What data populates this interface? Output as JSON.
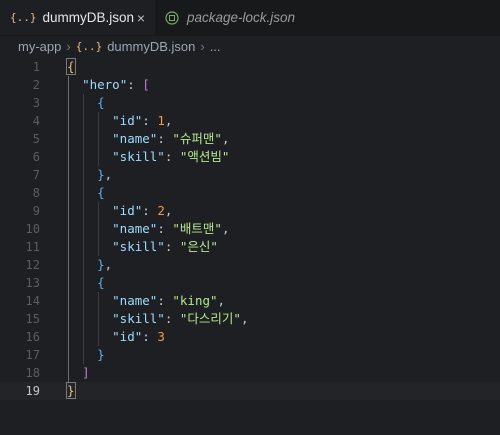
{
  "tabs": [
    {
      "icon": "{..}",
      "label": "dummyDB.json",
      "close": "×",
      "active": true
    },
    {
      "label": "package-lock.json",
      "active": false
    }
  ],
  "breadcrumb": {
    "folder": "my-app",
    "file_icon": "{..}",
    "file": "dummyDB.json",
    "more": "..."
  },
  "colors": {
    "brace": "#e5c07b",
    "bracket": "#c678dd",
    "inner_brace": "#61afef",
    "key": "#9cdcfe",
    "string": "#b5e890",
    "number": "#f09a4c"
  },
  "lines": [
    {
      "n": "1",
      "tokens": [
        [
          "{",
          "b1"
        ]
      ]
    },
    {
      "n": "2",
      "tokens": [
        [
          "  ",
          ""
        ],
        [
          "\"hero\"",
          "key"
        ],
        [
          ": ",
          "punc"
        ],
        [
          "[",
          "b2"
        ]
      ]
    },
    {
      "n": "3",
      "tokens": [
        [
          "    ",
          ""
        ],
        [
          "{",
          "b3"
        ]
      ]
    },
    {
      "n": "4",
      "tokens": [
        [
          "      ",
          ""
        ],
        [
          "\"id\"",
          "key"
        ],
        [
          ": ",
          "punc"
        ],
        [
          "1",
          "num"
        ],
        [
          ",",
          "punc"
        ]
      ]
    },
    {
      "n": "5",
      "tokens": [
        [
          "      ",
          ""
        ],
        [
          "\"name\"",
          "key"
        ],
        [
          ": ",
          "punc"
        ],
        [
          "\"슈퍼맨\"",
          "str"
        ],
        [
          ",",
          "punc"
        ]
      ]
    },
    {
      "n": "6",
      "tokens": [
        [
          "      ",
          ""
        ],
        [
          "\"skill\"",
          "key"
        ],
        [
          ": ",
          "punc"
        ],
        [
          "\"액션빔\"",
          "str"
        ]
      ]
    },
    {
      "n": "7",
      "tokens": [
        [
          "    ",
          ""
        ],
        [
          "}",
          "b3"
        ],
        [
          ",",
          "punc"
        ]
      ]
    },
    {
      "n": "8",
      "tokens": [
        [
          "    ",
          ""
        ],
        [
          "{",
          "b3"
        ]
      ]
    },
    {
      "n": "9",
      "tokens": [
        [
          "      ",
          ""
        ],
        [
          "\"id\"",
          "key"
        ],
        [
          ": ",
          "punc"
        ],
        [
          "2",
          "num"
        ],
        [
          ",",
          "punc"
        ]
      ]
    },
    {
      "n": "10",
      "tokens": [
        [
          "      ",
          ""
        ],
        [
          "\"name\"",
          "key"
        ],
        [
          ": ",
          "punc"
        ],
        [
          "\"배트맨\"",
          "str"
        ],
        [
          ",",
          "punc"
        ]
      ]
    },
    {
      "n": "11",
      "tokens": [
        [
          "      ",
          ""
        ],
        [
          "\"skill\"",
          "key"
        ],
        [
          ": ",
          "punc"
        ],
        [
          "\"은신\"",
          "str"
        ]
      ]
    },
    {
      "n": "12",
      "tokens": [
        [
          "    ",
          ""
        ],
        [
          "}",
          "b3"
        ],
        [
          ",",
          "punc"
        ]
      ]
    },
    {
      "n": "13",
      "tokens": [
        [
          "    ",
          ""
        ],
        [
          "{",
          "b3"
        ]
      ]
    },
    {
      "n": "14",
      "tokens": [
        [
          "      ",
          ""
        ],
        [
          "\"name\"",
          "key"
        ],
        [
          ": ",
          "punc"
        ],
        [
          "\"king\"",
          "str"
        ],
        [
          ",",
          "punc"
        ]
      ]
    },
    {
      "n": "15",
      "tokens": [
        [
          "      ",
          ""
        ],
        [
          "\"skill\"",
          "key"
        ],
        [
          ": ",
          "punc"
        ],
        [
          "\"다스리기\"",
          "str"
        ],
        [
          ",",
          "punc"
        ]
      ]
    },
    {
      "n": "16",
      "tokens": [
        [
          "      ",
          ""
        ],
        [
          "\"id\"",
          "key"
        ],
        [
          ": ",
          "punc"
        ],
        [
          "3",
          "num"
        ]
      ]
    },
    {
      "n": "17",
      "tokens": [
        [
          "    ",
          ""
        ],
        [
          "}",
          "b3"
        ]
      ]
    },
    {
      "n": "18",
      "tokens": [
        [
          "  ",
          ""
        ],
        [
          "]",
          "b2"
        ]
      ]
    },
    {
      "n": "19",
      "tokens": [
        [
          "}",
          "b1"
        ]
      ]
    }
  ],
  "current_line": "19"
}
